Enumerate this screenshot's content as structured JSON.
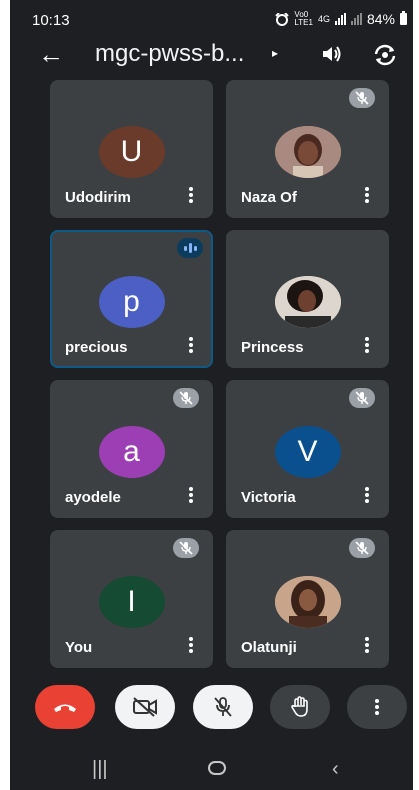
{
  "status": {
    "time": "10:13",
    "net_top": "Vo0",
    "net_bottom": "LTE1",
    "net_type_top": "4G",
    "battery": "84%"
  },
  "header": {
    "title": "mgc-pwss-b...",
    "caret": "▸"
  },
  "participants": [
    {
      "name": "Udodirim",
      "initial": "U",
      "avatar_color": "#6a3b2a",
      "muted": false,
      "speaking": false,
      "photo": false
    },
    {
      "name": "Naza Of",
      "initial": "",
      "avatar_color": "#b58a7a",
      "muted": true,
      "speaking": false,
      "photo": true
    },
    {
      "name": "precious",
      "initial": "p",
      "avatar_color": "#4b5fc4",
      "muted": false,
      "speaking": true,
      "photo": false
    },
    {
      "name": "Princess",
      "initial": "",
      "avatar_color": "#d9d2cc",
      "muted": false,
      "speaking": false,
      "photo": true
    },
    {
      "name": "ayodele",
      "initial": "a",
      "avatar_color": "#9c3fb4",
      "muted": true,
      "speaking": false,
      "photo": false
    },
    {
      "name": "Victoria",
      "initial": "V",
      "avatar_color": "#0a4f8e",
      "muted": true,
      "speaking": false,
      "photo": false
    },
    {
      "name": "You",
      "initial": "I",
      "avatar_color": "#154b33",
      "muted": true,
      "speaking": false,
      "photo": false
    },
    {
      "name": "Olatunji",
      "initial": "",
      "avatar_color": "#c9a68a",
      "muted": true,
      "speaking": false,
      "photo": true
    }
  ],
  "icons": {
    "back": "back-arrow-icon",
    "speaker": "speaker-icon",
    "camera_switch": "camera-switch-icon",
    "end_call": "end-call-icon",
    "camera_off": "camera-off-icon",
    "mic_off": "mic-off-icon",
    "raise_hand": "raise-hand-icon",
    "more": "more-vert-icon"
  },
  "colors": {
    "end_call": "#e94235",
    "control_light": "#f1f3f4",
    "control_dark": "#3c4043",
    "tile": "#3c4043",
    "active_border": "#0e5a86"
  }
}
